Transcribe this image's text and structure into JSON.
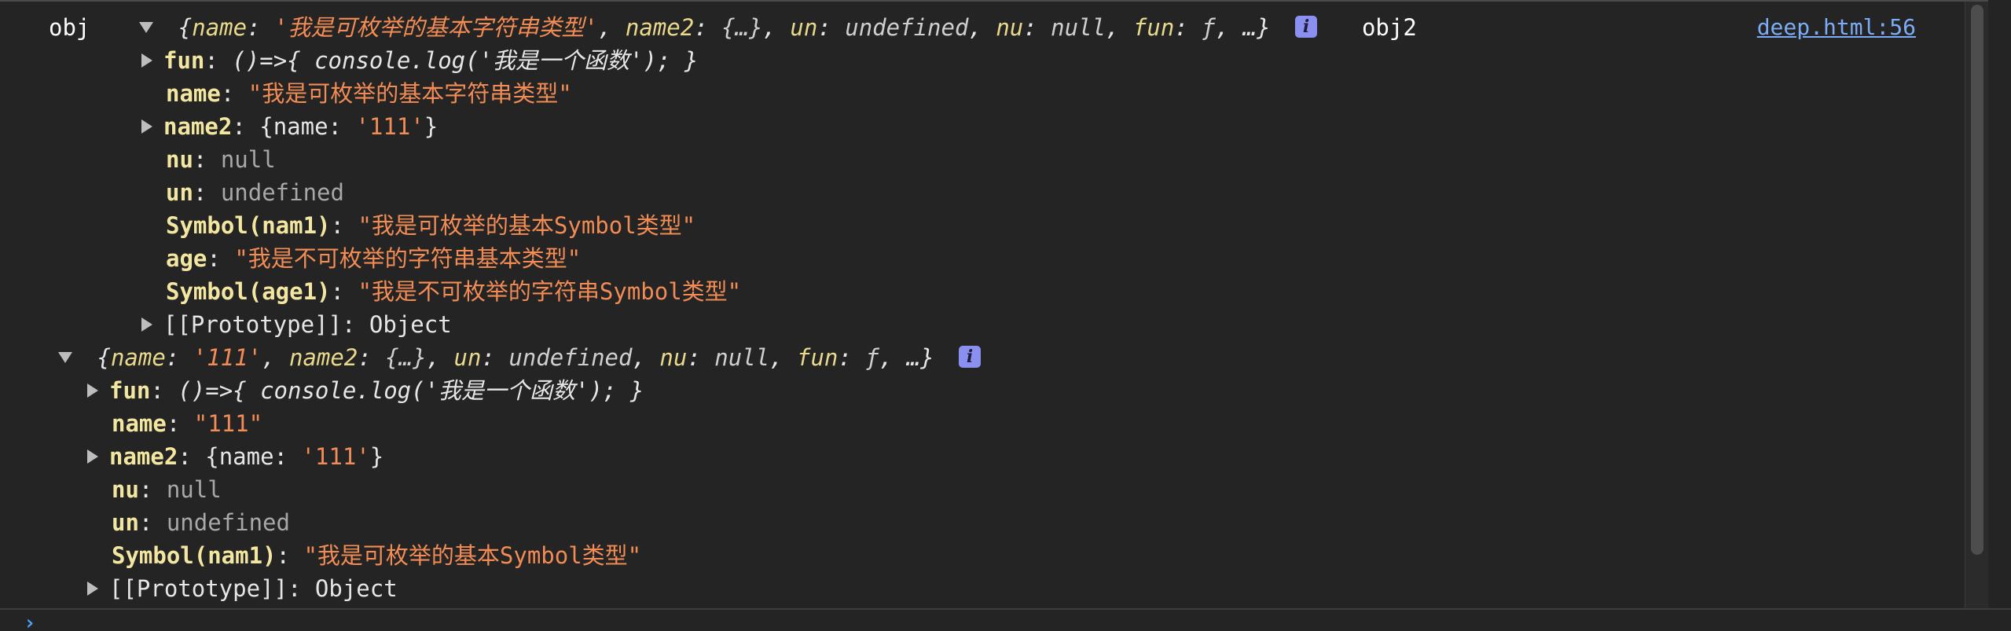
{
  "source_link": "deep.html:56",
  "obj_label": "obj",
  "obj2_label": "obj2",
  "icons": {
    "expand": "triangle-right-icon",
    "collapse": "triangle-down-icon",
    "info": "info-icon",
    "prompt": "chevron-right-icon"
  },
  "obj_summary": {
    "open": "{",
    "k1": "name",
    "v1": "'我是可枚举的基本字符串类型'",
    "k2": "name2",
    "v2": "{…}",
    "k3": "un",
    "v3": "undefined",
    "k4": "nu",
    "v4": "null",
    "k5": "fun",
    "v5": "ƒ",
    "close": "…}"
  },
  "obj_props": [
    {
      "key": "fun",
      "value": "()=>{ console.log('我是一个函数'); }"
    },
    {
      "key": "name",
      "value": "\"我是可枚举的基本字符串类型\""
    },
    {
      "key": "name2",
      "value_open": "{",
      "inner_key": "name",
      "inner_value": "'111'",
      "value_close": "}"
    },
    {
      "key": "nu",
      "value": "null"
    },
    {
      "key": "un",
      "value": "undefined"
    },
    {
      "key": "Symbol(nam1)",
      "value": "\"我是可枚举的基本Symbol类型\""
    },
    {
      "key": "age",
      "value": "\"我是不可枚举的字符串基本类型\""
    },
    {
      "key": "Symbol(age1)",
      "value": "\"我是不可枚举的字符串Symbol类型\""
    },
    {
      "key": "[[Prototype]]",
      "value": "Object"
    }
  ],
  "obj2_summary": {
    "open": "{",
    "k1": "name",
    "v1": "'111'",
    "k2": "name2",
    "v2": "{…}",
    "k3": "un",
    "v3": "undefined",
    "k4": "nu",
    "v4": "null",
    "k5": "fun",
    "v5": "ƒ",
    "close": "…}"
  },
  "obj2_props": [
    {
      "key": "fun",
      "value": "()=>{ console.log('我是一个函数'); }"
    },
    {
      "key": "name",
      "value": "\"111\""
    },
    {
      "key": "name2",
      "value_open": "{",
      "inner_key": "name",
      "inner_value": "'111'",
      "value_close": "}"
    },
    {
      "key": "nu",
      "value": "null"
    },
    {
      "key": "un",
      "value": "undefined"
    },
    {
      "key": "Symbol(nam1)",
      "value": "\"我是可枚举的基本Symbol类型\""
    },
    {
      "key": "[[Prototype]]",
      "value": "Object"
    }
  ]
}
